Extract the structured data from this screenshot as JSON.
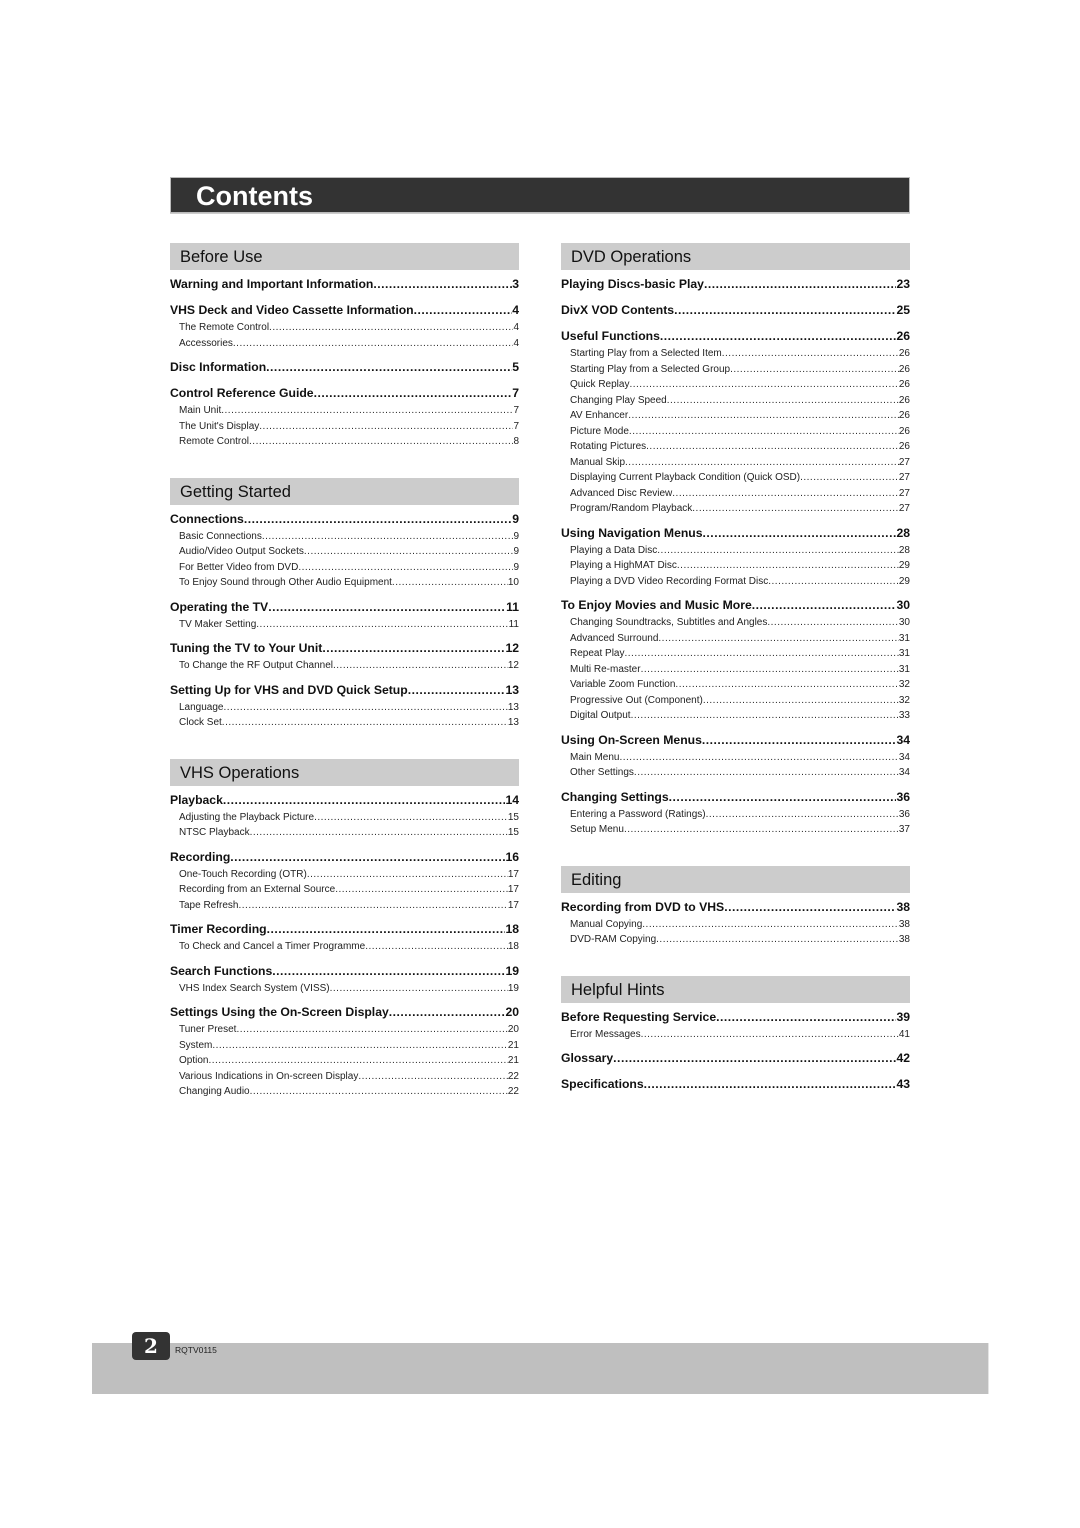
{
  "title": "Contents",
  "columns": [
    {
      "sections": [
        {
          "heading": "Before Use",
          "entries": [
            {
              "title": "Warning and Important Information",
              "page": "3",
              "subs": []
            },
            {
              "title": "VHS Deck and Video Cassette Information",
              "page": "4",
              "subs": [
                {
                  "title": "The Remote Control",
                  "page": "4"
                },
                {
                  "title": "Accessories",
                  "page": "4"
                }
              ]
            },
            {
              "title": "Disc Information",
              "page": "5",
              "subs": []
            },
            {
              "title": "Control Reference Guide",
              "page": "7",
              "subs": [
                {
                  "title": "Main Unit",
                  "page": "7"
                },
                {
                  "title": "The Unit's Display",
                  "page": "7"
                },
                {
                  "title": "Remote Control",
                  "page": "8"
                }
              ]
            }
          ]
        },
        {
          "heading": "Getting Started",
          "entries": [
            {
              "title": "Connections",
              "page": "9",
              "subs": [
                {
                  "title": "Basic Connections",
                  "page": "9"
                },
                {
                  "title": "Audio/Video Output Sockets",
                  "page": "9"
                },
                {
                  "title": "For Better Video from DVD",
                  "page": "9"
                },
                {
                  "title": "To Enjoy Sound through Other Audio Equipment",
                  "page": "10"
                }
              ]
            },
            {
              "title": "Operating the TV",
              "page": "11",
              "subs": [
                {
                  "title": "TV Maker Setting",
                  "page": "11"
                }
              ]
            },
            {
              "title": "Tuning the TV to Your Unit",
              "page": "12",
              "subs": [
                {
                  "title": "To Change the RF Output Channel",
                  "page": "12"
                }
              ]
            },
            {
              "title": "Setting Up for VHS and DVD Quick Setup",
              "page": "13",
              "subs": [
                {
                  "title": "Language",
                  "page": "13"
                },
                {
                  "title": "Clock Set",
                  "page": "13"
                }
              ]
            }
          ]
        },
        {
          "heading": "VHS Operations",
          "entries": [
            {
              "title": "Playback",
              "page": "14",
              "subs": [
                {
                  "title": "Adjusting the Playback Picture",
                  "page": "15"
                },
                {
                  "title": "NTSC Playback",
                  "page": "15"
                }
              ]
            },
            {
              "title": "Recording",
              "page": "16",
              "subs": [
                {
                  "title": "One-Touch Recording (OTR)",
                  "page": "17"
                },
                {
                  "title": "Recording from an External Source",
                  "page": "17"
                },
                {
                  "title": "Tape Refresh",
                  "page": "17"
                }
              ]
            },
            {
              "title": "Timer Recording",
              "page": "18",
              "subs": [
                {
                  "title": "To Check and Cancel a Timer Programme",
                  "page": "18"
                }
              ]
            },
            {
              "title": "Search Functions",
              "page": "19",
              "subs": [
                {
                  "title": "VHS Index Search System (VISS)",
                  "page": "19"
                }
              ]
            },
            {
              "title": "Settings Using the On-Screen Display",
              "page": "20",
              "subs": [
                {
                  "title": "Tuner Preset",
                  "page": "20"
                },
                {
                  "title": "System",
                  "page": "21"
                },
                {
                  "title": "Option",
                  "page": "21"
                },
                {
                  "title": "Various Indications in On-screen Display",
                  "page": "22"
                },
                {
                  "title": "Changing Audio",
                  "page": "22"
                }
              ]
            }
          ]
        }
      ]
    },
    {
      "sections": [
        {
          "heading": "DVD Operations",
          "entries": [
            {
              "title": "Playing Discs-basic Play",
              "page": "23",
              "subs": []
            },
            {
              "title": "DivX VOD Contents",
              "page": "25",
              "subs": []
            },
            {
              "title": "Useful Functions",
              "page": "26",
              "subs": [
                {
                  "title": "Starting Play from a Selected Item",
                  "page": "26"
                },
                {
                  "title": "Starting Play from a Selected Group",
                  "page": "26"
                },
                {
                  "title": "Quick Replay",
                  "page": "26"
                },
                {
                  "title": "Changing Play Speed",
                  "page": "26"
                },
                {
                  "title": "AV Enhancer",
                  "page": "26"
                },
                {
                  "title": "Picture Mode",
                  "page": "26"
                },
                {
                  "title": "Rotating Pictures",
                  "page": "26"
                },
                {
                  "title": "Manual Skip",
                  "page": "27"
                },
                {
                  "title": "Displaying Current Playback Condition (Quick OSD)",
                  "page": "27"
                },
                {
                  "title": "Advanced Disc Review",
                  "page": "27"
                },
                {
                  "title": "Program/Random Playback",
                  "page": "27"
                }
              ]
            },
            {
              "title": "Using Navigation Menus",
              "page": "28",
              "subs": [
                {
                  "title": "Playing a Data Disc",
                  "page": "28"
                },
                {
                  "title": "Playing a HighMAT Disc",
                  "page": "29"
                },
                {
                  "title": "Playing a DVD Video Recording Format Disc",
                  "page": "29"
                }
              ]
            },
            {
              "title": "To Enjoy Movies and Music More",
              "page": "30",
              "subs": [
                {
                  "title": "Changing Soundtracks, Subtitles and Angles",
                  "page": "30"
                },
                {
                  "title": "Advanced Surround",
                  "page": "31"
                },
                {
                  "title": "Repeat Play",
                  "page": "31"
                },
                {
                  "title": "Multi Re-master",
                  "page": "31"
                },
                {
                  "title": "Variable Zoom Function",
                  "page": "32"
                },
                {
                  "title": "Progressive Out (Component)",
                  "page": "32"
                },
                {
                  "title": "Digital Output",
                  "page": "33"
                }
              ]
            },
            {
              "title": "Using On-Screen Menus",
              "page": "34",
              "subs": [
                {
                  "title": "Main Menu",
                  "page": "34"
                },
                {
                  "title": "Other Settings",
                  "page": "34"
                }
              ]
            },
            {
              "title": "Changing Settings",
              "page": "36",
              "subs": [
                {
                  "title": "Entering a Password (Ratings)",
                  "page": "36"
                },
                {
                  "title": "Setup Menu",
                  "page": "37"
                }
              ]
            }
          ]
        },
        {
          "heading": "Editing",
          "entries": [
            {
              "title": "Recording from DVD to VHS",
              "page": "38",
              "subs": [
                {
                  "title": "Manual Copying",
                  "page": "38"
                },
                {
                  "title": "DVD-RAM Copying",
                  "page": "38"
                }
              ]
            }
          ]
        },
        {
          "heading": "Helpful Hints",
          "entries": [
            {
              "title": "Before Requesting Service",
              "page": "39",
              "subs": [
                {
                  "title": "Error Messages",
                  "page": "41"
                }
              ]
            },
            {
              "title": "Glossary",
              "page": "42",
              "subs": []
            },
            {
              "title": "Specifications",
              "page": "43",
              "subs": []
            }
          ]
        }
      ]
    }
  ],
  "footer": {
    "page_number": "2",
    "doc_code": "RQTV0115"
  }
}
